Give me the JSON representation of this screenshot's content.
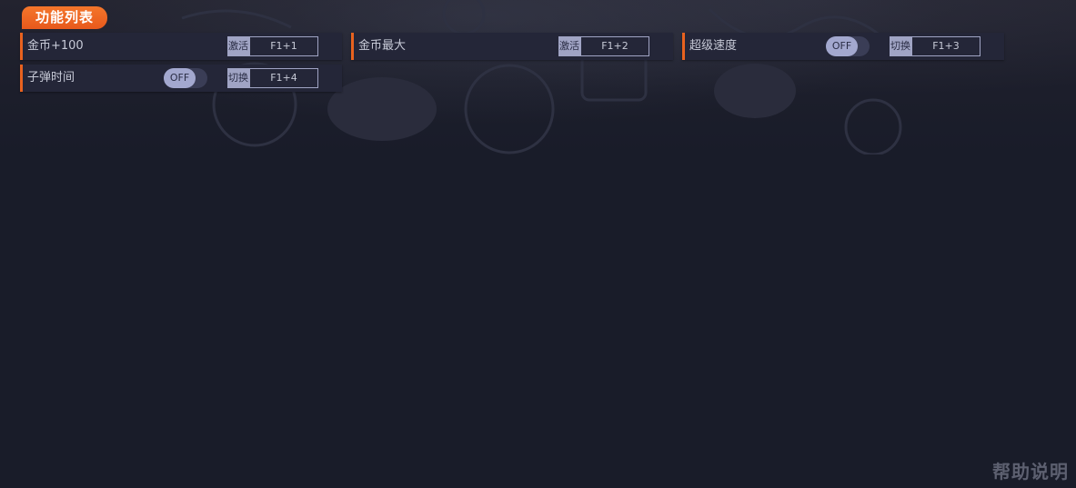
{
  "header": {
    "title": "功能列表"
  },
  "features": [
    {
      "label": "金币+100",
      "type": "activate",
      "action": "激活",
      "hotkey": "F1+1"
    },
    {
      "label": "金币最大",
      "type": "activate",
      "action": "激活",
      "hotkey": "F1+2"
    },
    {
      "label": "超级速度",
      "type": "toggle",
      "state": "OFF",
      "action": "切换",
      "hotkey": "F1+3"
    },
    {
      "label": "子弹时间",
      "type": "toggle",
      "state": "OFF",
      "action": "切换",
      "hotkey": "F1+4"
    }
  ],
  "footer": {
    "help": "帮助说明"
  },
  "colors": {
    "accent": "#e8621f",
    "background": "#191c29",
    "row": "#242638",
    "chip": "#a0a4c4"
  }
}
